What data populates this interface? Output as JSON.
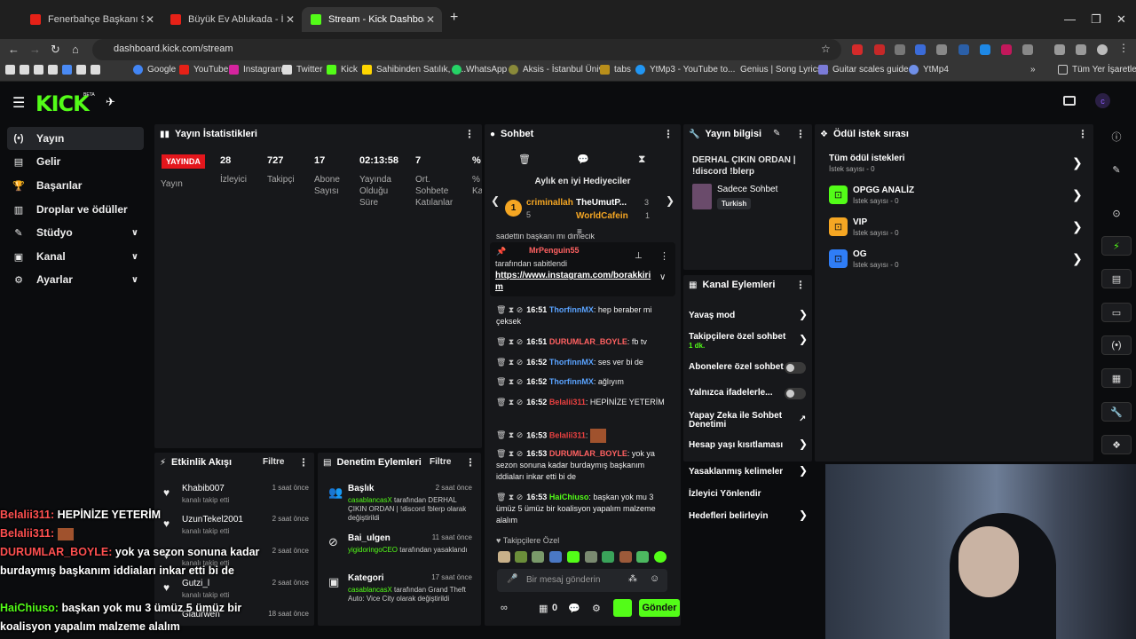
{
  "browser": {
    "tabs": [
      {
        "title": "Fenerbahçe Başkanı Sadettin Sa...",
        "color": "#e62117"
      },
      {
        "title": "Büyük Ev Ablukada - İHTİMALL...",
        "color": "#e62117"
      },
      {
        "title": "Stream - Kick Dashboard",
        "color": "#53fc18"
      }
    ],
    "url": "dashboard.kick.com/stream",
    "bookmarks": [
      "Google",
      "YouTube",
      "Instagram",
      "Twitter",
      "Kick",
      "Sahibinden Satılık, K...",
      "WhatsApp",
      "Aksis - İstanbul Üniv...",
      "tabs",
      "YtMp3 - YouTube to...",
      "Genius | Song Lyrics...",
      "Guitar scales guide...",
      "YtMp4",
      "Tüm Yer İşaretleri"
    ]
  },
  "app": {
    "logo": "KICK",
    "beta": "BETA"
  },
  "sidebar": {
    "items": [
      {
        "label": "Yayın",
        "icon": "(•)"
      },
      {
        "label": "Gelir",
        "icon": "▤"
      },
      {
        "label": "Başarılar",
        "icon": "🏆"
      },
      {
        "label": "Droplar ve ödüller",
        "icon": "▥"
      },
      {
        "label": "Stüdyo",
        "icon": "✎"
      },
      {
        "label": "Kanal",
        "icon": "▣"
      },
      {
        "label": "Ayarlar",
        "icon": "⚙"
      }
    ]
  },
  "stats": {
    "title": "Yayın İstatistikleri",
    "live": "YAYINDA",
    "live_label": "Yayın",
    "viewers": "28",
    "viewers_label": "İzleyici",
    "followers": "727",
    "followers_label": "Takipçi",
    "subs": "17",
    "subs_label": "Abone Sayısı",
    "duration": "02:13:58",
    "duration_label": "Yayında Olduğu Süre",
    "chatters": "7",
    "chatters_label": "Ort. Sohbete Katılanlar",
    "pct": "%",
    "pct_label": "% Ka"
  },
  "activity": {
    "title": "Etkinlik Akışı",
    "filter": "Filtre",
    "items": [
      {
        "name": "Khabib007",
        "desc": "kanalı takip etti",
        "time": "1 saat önce"
      },
      {
        "name": "UzunTekel2001",
        "desc": "kanalı takip etti",
        "time": "2 saat önce"
      },
      {
        "name": "",
        "desc": "kanalı takip etti",
        "time": "2 saat önce"
      },
      {
        "name": "Gutzi_l",
        "desc": "kanalı takip etti",
        "time": "2 saat önce"
      },
      {
        "name": "Glaurwen",
        "desc": "",
        "time": "18 saat önce"
      }
    ]
  },
  "moderation": {
    "title": "Denetim Eylemleri",
    "filter": "Filtre",
    "items": [
      {
        "name": "Başlık",
        "time": "2 saat önce",
        "user": "casablancasX",
        "text": " tarafından DERHAL ÇIKIN ORDAN | !discord !blerp olarak değiştirildi"
      },
      {
        "name": "Bai_ulgen",
        "time": "11 saat önce",
        "user": "yigidoringoCEO",
        "text": " tarafından yasaklandı"
      },
      {
        "name": "Kategori",
        "time": "17 saat önce",
        "user": "casablancasX",
        "text": " tarafından Grand Theft Auto: Vice City olarak değiştirildi"
      }
    ]
  },
  "chat": {
    "title": "Sohbet",
    "gifters_title": "Aylık en iyi Hediyeciler",
    "gifter1": {
      "rank": "1",
      "name": "criminallah",
      "count": "5"
    },
    "gifter2": {
      "name": "TheUmutP...",
      "count": "3"
    },
    "gifter3": {
      "name": "WorldCafein",
      "count": "1"
    },
    "partial": "sadettin başkanı mı dimecik",
    "pinned_by": "MrPenguin55",
    "pinned_label": "tarafından sabitlendi",
    "pinned_link": "https://www.instagram.com/borakkirim",
    "messages": [
      {
        "time": "16:51",
        "user": "ThorfinnMX",
        "text": ": hep beraber mi çeksek",
        "cls": "u1"
      },
      {
        "time": "16:51",
        "user": "DURUMLAR_BOYLE",
        "text": ": fb tv",
        "cls": "u2"
      },
      {
        "time": "16:52",
        "user": "ThorfinnMX",
        "text": ": ses ver bi de",
        "cls": "u1"
      },
      {
        "time": "16:52",
        "user": "ThorfinnMX",
        "text": ": ağlıyım",
        "cls": "u1"
      },
      {
        "time": "16:52",
        "user": "Belalii311",
        "text": ": HEPİNİZE YETERİM",
        "cls": "u4"
      },
      {
        "time": "16:53",
        "user": "Belalii311",
        "text": ":",
        "cls": "u4"
      },
      {
        "time": "16:53",
        "user": "DURUMLAR_BOYLE",
        "text": ": yok ya sezon sonuna kadar burdaymış başkanım iddiaları inkar etti bi de",
        "cls": "u2"
      },
      {
        "time": "16:53",
        "user": "HaiChiuso",
        "text": ": başkan yok mu 3 ümüz 5 ümüz bir koalisyon yapalım malzeme alalım",
        "cls": "u3"
      }
    ],
    "emote_label": "Takipçilere Özel",
    "placeholder": "Bir mesaj gönderin",
    "count": "0",
    "send": "Gönder"
  },
  "stream_info": {
    "title": "Yayın bilgisi",
    "stream_title": "DERHAL ÇIKIN ORDAN | !discord !blerp",
    "category": "Sadece Sohbet",
    "tag": "Turkish"
  },
  "channel_actions": {
    "title": "Kanal Eylemleri",
    "items": [
      "Yavaş mod",
      "Takipçilere özel sohbet",
      "Abonelere özel sohbet",
      "Yalnızca ifadelerle...",
      "Yapay Zeka ile Sohbet Denetimi",
      "Hesap yaşı kısıtlaması",
      "Yasaklanmış kelimeler",
      "İzleyici Yönlendir",
      "Hedefleri belirleyin"
    ],
    "follower_sub": "1 dk."
  },
  "rewards": {
    "title": "Ödül istek sırası",
    "items": [
      {
        "name": "Tüm ödül istekleri",
        "sub": "İstek sayısı - 0"
      },
      {
        "name": "OPGG ANALİZ",
        "sub": "İstek sayısı - 0",
        "color": "#53fc18"
      },
      {
        "name": "VIP",
        "sub": "İstek sayısı - 0",
        "color": "#f5a623"
      },
      {
        "name": "OG",
        "sub": "İstek sayısı - 0",
        "color": "#2f7df6"
      }
    ]
  },
  "overlay_chat": [
    {
      "user": "Belalii311:",
      "text": " HEPİNİZE YETERİM"
    },
    {
      "user": "Belalii311:",
      "text": ""
    },
    {
      "user": "DURUMLAR_BOYLE:",
      "text": " yok ya sezon sonuna kadar burdaymış başkanım iddiaları inkar etti bi de"
    },
    {
      "user": "HaiChiuso:",
      "text": " başkan yok mu 3 ümüz 5 ümüz bir koalisyon yapalım malzeme alalım"
    }
  ]
}
